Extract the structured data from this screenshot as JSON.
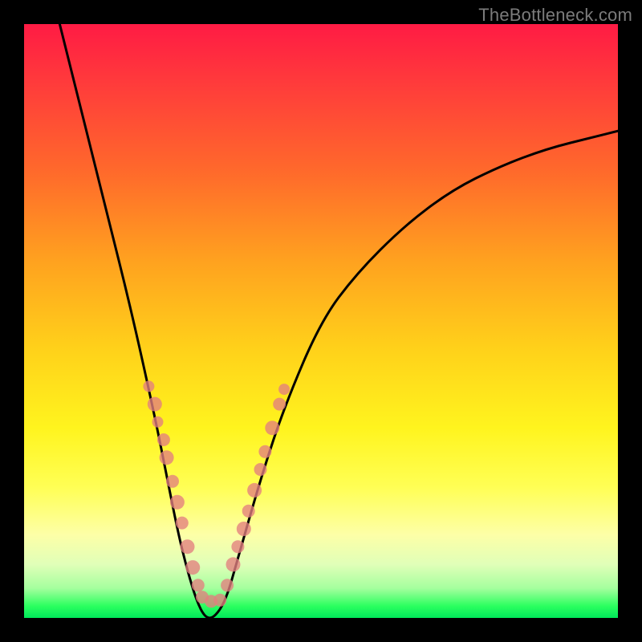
{
  "watermark": "TheBottleneck.com",
  "colors": {
    "frame": "#000000",
    "curve": "#000000",
    "dot": "#e37f7f",
    "gradient_stops": [
      "#ff1b44",
      "#ff3b3b",
      "#ff6a2b",
      "#ffa21f",
      "#ffd21a",
      "#fff41e",
      "#ffff55",
      "#fdffa7",
      "#e0ffb8",
      "#a5ff9e",
      "#2bff5f",
      "#00e85a"
    ]
  },
  "chart_data": {
    "type": "line",
    "title": "",
    "xlabel": "",
    "ylabel": "",
    "xlim": [
      0,
      100
    ],
    "ylim": [
      0,
      100
    ],
    "grid": false,
    "legend": false,
    "series": [
      {
        "name": "bottleneck-curve",
        "x": [
          6,
          10,
          14,
          18,
          22,
          24,
          26,
          27.5,
          29,
          30.5,
          32,
          34,
          36,
          40,
          44,
          50,
          56,
          64,
          72,
          80,
          88,
          96,
          100
        ],
        "y": [
          100,
          84,
          68,
          52,
          34,
          24,
          14,
          8,
          3,
          0,
          0,
          3,
          10,
          24,
          36,
          50,
          58,
          66,
          72,
          76,
          79,
          81,
          82
        ]
      }
    ],
    "annotations": {
      "dots_left": {
        "note": "beads along left arm of V (approx plot-fraction coords)",
        "points": [
          {
            "x": 0.21,
            "y": 0.61,
            "r": 7
          },
          {
            "x": 0.22,
            "y": 0.64,
            "r": 9
          },
          {
            "x": 0.225,
            "y": 0.67,
            "r": 7
          },
          {
            "x": 0.235,
            "y": 0.7,
            "r": 8
          },
          {
            "x": 0.24,
            "y": 0.73,
            "r": 9
          },
          {
            "x": 0.25,
            "y": 0.77,
            "r": 8
          },
          {
            "x": 0.258,
            "y": 0.805,
            "r": 9
          },
          {
            "x": 0.266,
            "y": 0.84,
            "r": 8
          },
          {
            "x": 0.275,
            "y": 0.88,
            "r": 9
          },
          {
            "x": 0.284,
            "y": 0.915,
            "r": 9
          },
          {
            "x": 0.293,
            "y": 0.945,
            "r": 8
          }
        ]
      },
      "dots_bottom": {
        "note": "beads across valley bottom",
        "points": [
          {
            "x": 0.3,
            "y": 0.965,
            "r": 8
          },
          {
            "x": 0.315,
            "y": 0.972,
            "r": 8
          },
          {
            "x": 0.33,
            "y": 0.97,
            "r": 8
          }
        ]
      },
      "dots_right": {
        "note": "beads along right arm of V",
        "points": [
          {
            "x": 0.342,
            "y": 0.945,
            "r": 8
          },
          {
            "x": 0.352,
            "y": 0.91,
            "r": 9
          },
          {
            "x": 0.36,
            "y": 0.88,
            "r": 8
          },
          {
            "x": 0.37,
            "y": 0.85,
            "r": 9
          },
          {
            "x": 0.378,
            "y": 0.82,
            "r": 8
          },
          {
            "x": 0.388,
            "y": 0.785,
            "r": 9
          },
          {
            "x": 0.398,
            "y": 0.75,
            "r": 8
          },
          {
            "x": 0.406,
            "y": 0.72,
            "r": 8
          },
          {
            "x": 0.418,
            "y": 0.68,
            "r": 9
          },
          {
            "x": 0.43,
            "y": 0.64,
            "r": 8
          },
          {
            "x": 0.438,
            "y": 0.615,
            "r": 7
          }
        ]
      }
    }
  }
}
